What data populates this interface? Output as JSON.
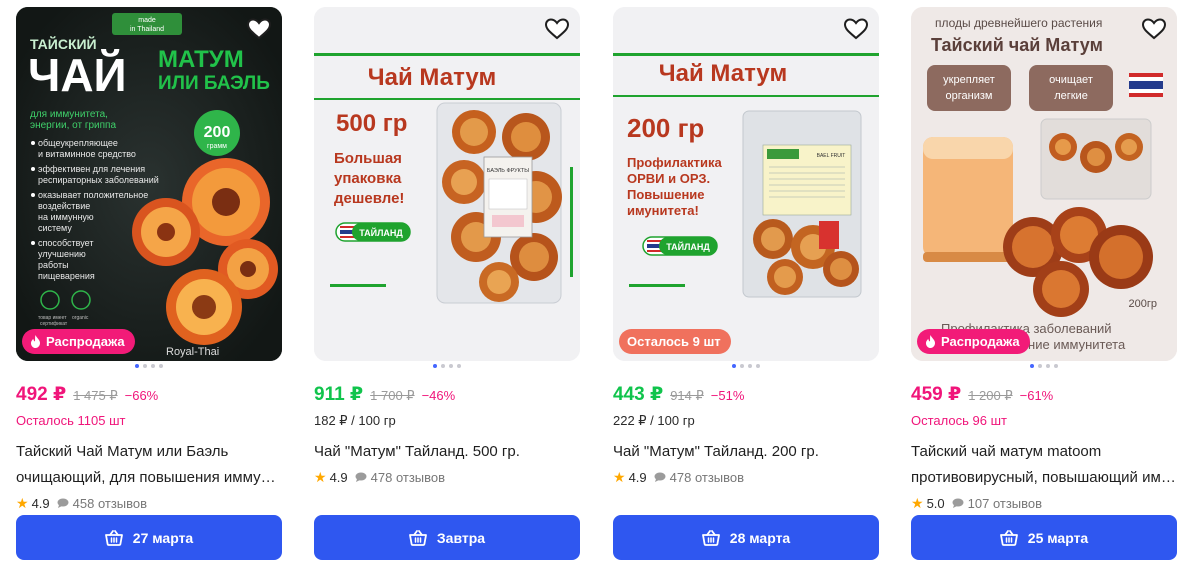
{
  "accent": "#2f57f0",
  "products": [
    {
      "image": {
        "made_in": "made\nin Thailand",
        "line1": "ТАЙСКИЙ",
        "big": "ЧАЙ",
        "green1": "МАТУМ",
        "green2": "ИЛИ БАЭЛЬ",
        "lead": "для иммунитета, энергии, от гриппа",
        "bullets": [
          "общеукрепляющее и витаминное средство",
          "эффективен для лечения респираторных заболеваний",
          "оказывает положительное воздействие на иммунную систему",
          "способствует улучшению работы пищеварения"
        ],
        "weight_num": "200",
        "weight_unit": "грамм",
        "cert1": "товар имеет сертификат",
        "cert2": "organic",
        "brand": "Royal-Thai"
      },
      "badge": "Распродажа",
      "price": "492 ₽",
      "old_price": "1 475 ₽",
      "discount": "−66%",
      "sub": "Осталось 1105 шт",
      "title_l1": "Тайский Чай Матум или Баэль",
      "title_l2": "очищающий, для повышения иммунитета",
      "rating": "4.9",
      "reviews": "458 отзывов",
      "delivery": "27 марта"
    },
    {
      "image": {
        "header": "Чай Матум",
        "weight": "500 гр",
        "promo": "Большая упаковка дешевле!",
        "country": "ТАЙЛАНД",
        "pack_label": "БАЭЛЬ ФРУКТЫ"
      },
      "badge": "",
      "price": "911 ₽",
      "old_price": "1 700 ₽",
      "discount": "−46%",
      "sub": "182 ₽ / 100 гр",
      "title_l1": "Чай \"Матум\" Тайланд. 500 гр.",
      "title_l2": "",
      "rating": "4.9",
      "reviews": "478 отзывов",
      "delivery": "Завтра"
    },
    {
      "image": {
        "header": "Чай Матум",
        "weight": "200 гр",
        "promo": "Профилактика ОРВИ и ОРЗ. Повышение имунитета!",
        "country": "ТАЙЛАНД",
        "pack_label": "BAEL FRUIT"
      },
      "badge": "Осталось 9 шт",
      "price": "443 ₽",
      "old_price": "914 ₽",
      "discount": "−51%",
      "sub": "222 ₽ / 100 гр",
      "title_l1": "Чай \"Матум\" Тайланд. 200 гр.",
      "title_l2": "",
      "rating": "4.9",
      "reviews": "478 отзывов",
      "delivery": "28 марта"
    },
    {
      "image": {
        "top": "плоды древнейшего растения",
        "title": "Тайский чай Матум",
        "pill1": "укрепляет организм",
        "pill2": "очищает легкие",
        "weight": "200гр",
        "bottom": "Профилактика заболеваний и повышение иммунитета"
      },
      "badge": "Распродажа",
      "price": "459 ₽",
      "old_price": "1 200 ₽",
      "discount": "−61%",
      "sub": "Осталось 96 шт",
      "title_l1": "Тайский чай матум matoom",
      "title_l2": "противовирусный, повышающий иммунитет",
      "rating": "5.0",
      "reviews": "107 отзывов",
      "delivery": "25 марта"
    }
  ]
}
